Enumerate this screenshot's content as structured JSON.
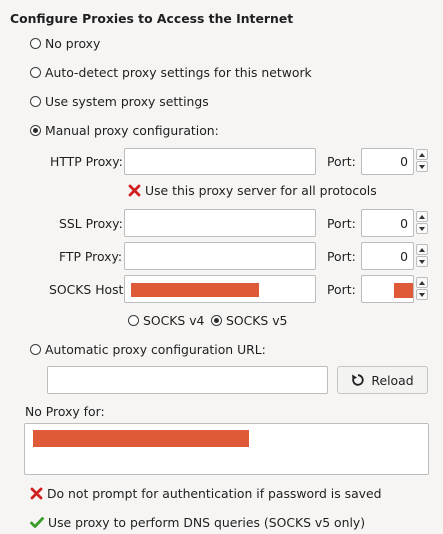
{
  "title": "Configure Proxies to Access the Internet",
  "modes": {
    "no_proxy": "No proxy",
    "auto_detect": "Auto-detect proxy settings for this network",
    "system": "Use system proxy settings",
    "manual": "Manual proxy configuration:",
    "auto_url": "Automatic proxy configuration URL:",
    "selected": "manual"
  },
  "manual": {
    "http_label": "HTTP Proxy:",
    "http_value": "",
    "http_port": "0",
    "share_label": "Use this proxy server for all protocols",
    "share_checked": false,
    "ssl_label": "SSL Proxy:",
    "ssl_value": "",
    "ssl_port": "0",
    "ftp_label": "FTP Proxy:",
    "ftp_value": "",
    "ftp_port": "0",
    "socks_label": "SOCKS Host:",
    "port_label": "Port:",
    "socks_v4": "SOCKS v4",
    "socks_v5": "SOCKS v5",
    "socks_version_selected": "v5"
  },
  "auto_url": {
    "value": "",
    "reload_label": "Reload"
  },
  "no_proxy": {
    "label": "No Proxy for:"
  },
  "options": {
    "no_auth_prompt": "Do not prompt for authentication if password is saved",
    "no_auth_prompt_checked": false,
    "dns_socks": "Use proxy to perform DNS queries (SOCKS v5 only)",
    "dns_socks_checked": true
  },
  "colors": {
    "redaction": "#df5a37",
    "cross": "#d11f1f",
    "check": "#3a9a2a"
  }
}
